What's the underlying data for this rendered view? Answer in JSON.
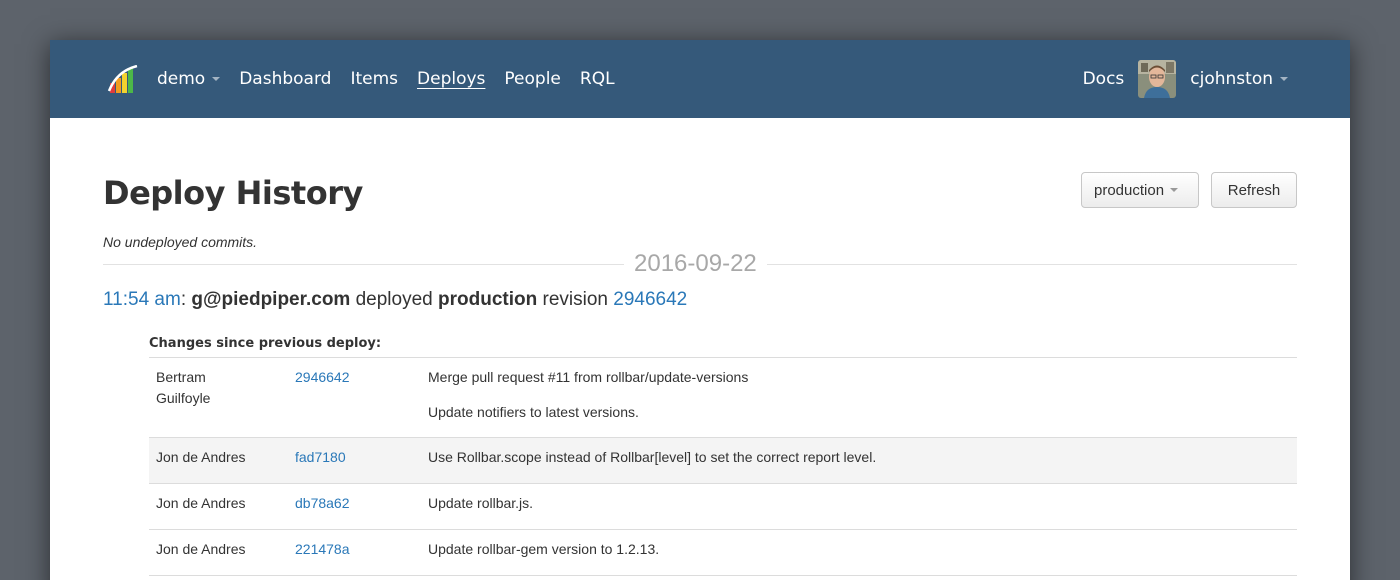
{
  "nav": {
    "project": "demo",
    "items": [
      {
        "label": "Dashboard",
        "active": false
      },
      {
        "label": "Items",
        "active": false
      },
      {
        "label": "Deploys",
        "active": true
      },
      {
        "label": "People",
        "active": false
      },
      {
        "label": "RQL",
        "active": false
      }
    ],
    "docs": "Docs",
    "user": "cjohnston",
    "bg_color": "#35597a"
  },
  "page": {
    "title": "Deploy History",
    "environment": "production",
    "refresh_label": "Refresh",
    "undeployed": "No undeployed commits."
  },
  "deploy": {
    "date": "2016-09-22",
    "time": "11:54 am",
    "colon": ":",
    "user": "g@piedpiper.com",
    "verb": "deployed",
    "environment": "production",
    "revision_word": "revision",
    "revision": "2946642",
    "changes_heading": "Changes since previous deploy:",
    "changes": [
      {
        "author": "Bertram Guilfoyle",
        "rev": "2946642",
        "messages": [
          "Merge pull request #11 from rollbar/update-versions",
          "Update notifiers to latest versions."
        ]
      },
      {
        "author": "Jon de Andres",
        "rev": "fad7180",
        "messages": [
          "Use Rollbar.scope instead of Rollbar[level] to set the correct report level."
        ]
      },
      {
        "author": "Jon de Andres",
        "rev": "db78a62",
        "messages": [
          "Update rollbar.js."
        ]
      },
      {
        "author": "Jon de Andres",
        "rev": "221478a",
        "messages": [
          "Update rollbar-gem version to 1.2.13."
        ]
      }
    ]
  },
  "colors": {
    "link": "#2a78b8",
    "backdrop": "#5d636b"
  }
}
